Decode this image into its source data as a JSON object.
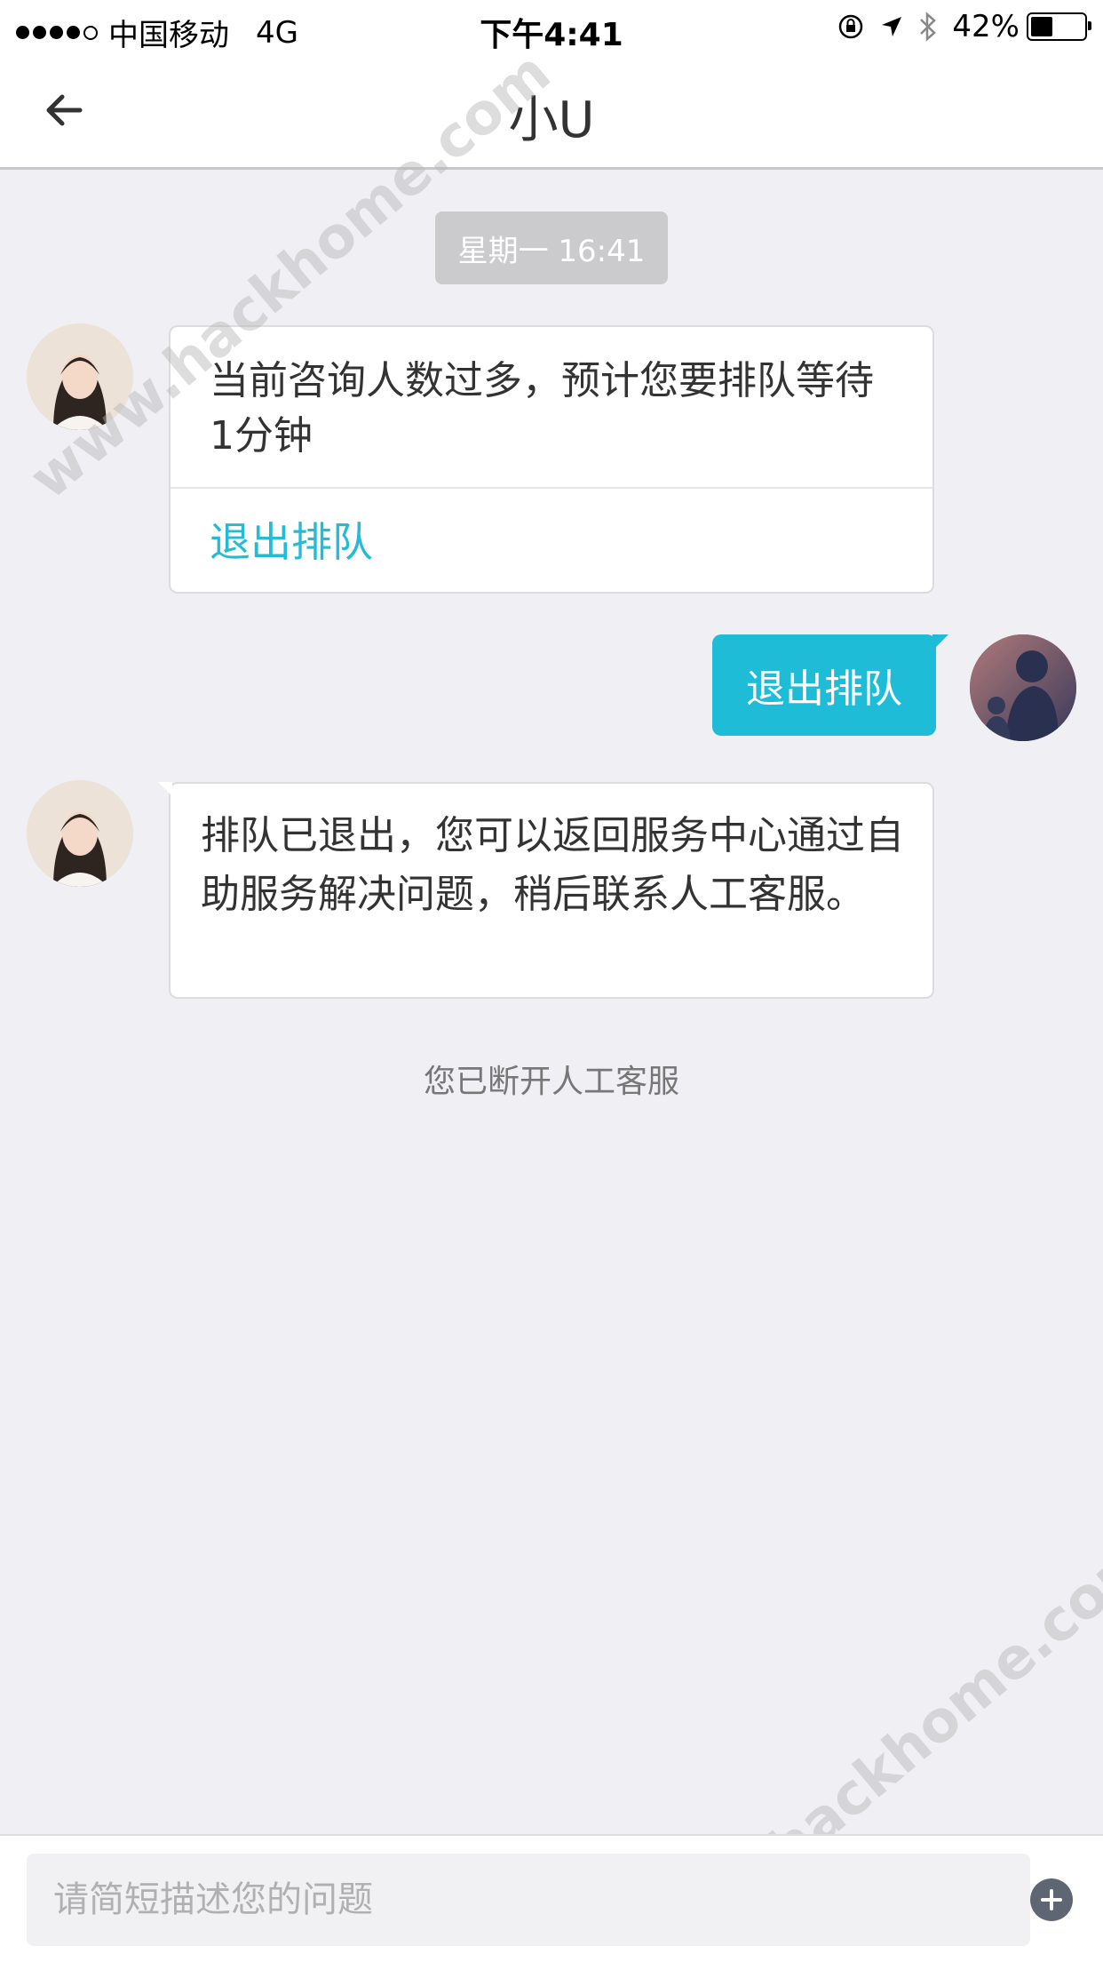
{
  "status_bar": {
    "carrier": "中国移动",
    "network": "4G",
    "time": "下午4:41",
    "battery_percent_label": "42%",
    "battery_level": 0.42
  },
  "header": {
    "title": "小U"
  },
  "chat": {
    "timestamp": "星期一 16:41",
    "messages": [
      {
        "from": "agent",
        "text": "当前咨询人数过多，预计您要排队等待1分钟",
        "action_label": "退出排队"
      },
      {
        "from": "user",
        "text": "退出排队"
      },
      {
        "from": "agent",
        "text": "排队已退出，您可以返回服务中心通过自助服务解决问题，稍后联系人工客服。"
      }
    ],
    "system_note": "您已断开人工客服"
  },
  "input": {
    "placeholder": "请简短描述您的问题"
  },
  "watermark": {
    "text": "www.hackhome.com"
  },
  "colors": {
    "accent": "#1fbcd8",
    "background": "#f0eff4",
    "plus_button": "#5f6673"
  },
  "icons": {
    "back": "arrow-left-icon",
    "plus": "plus-circle-icon"
  }
}
